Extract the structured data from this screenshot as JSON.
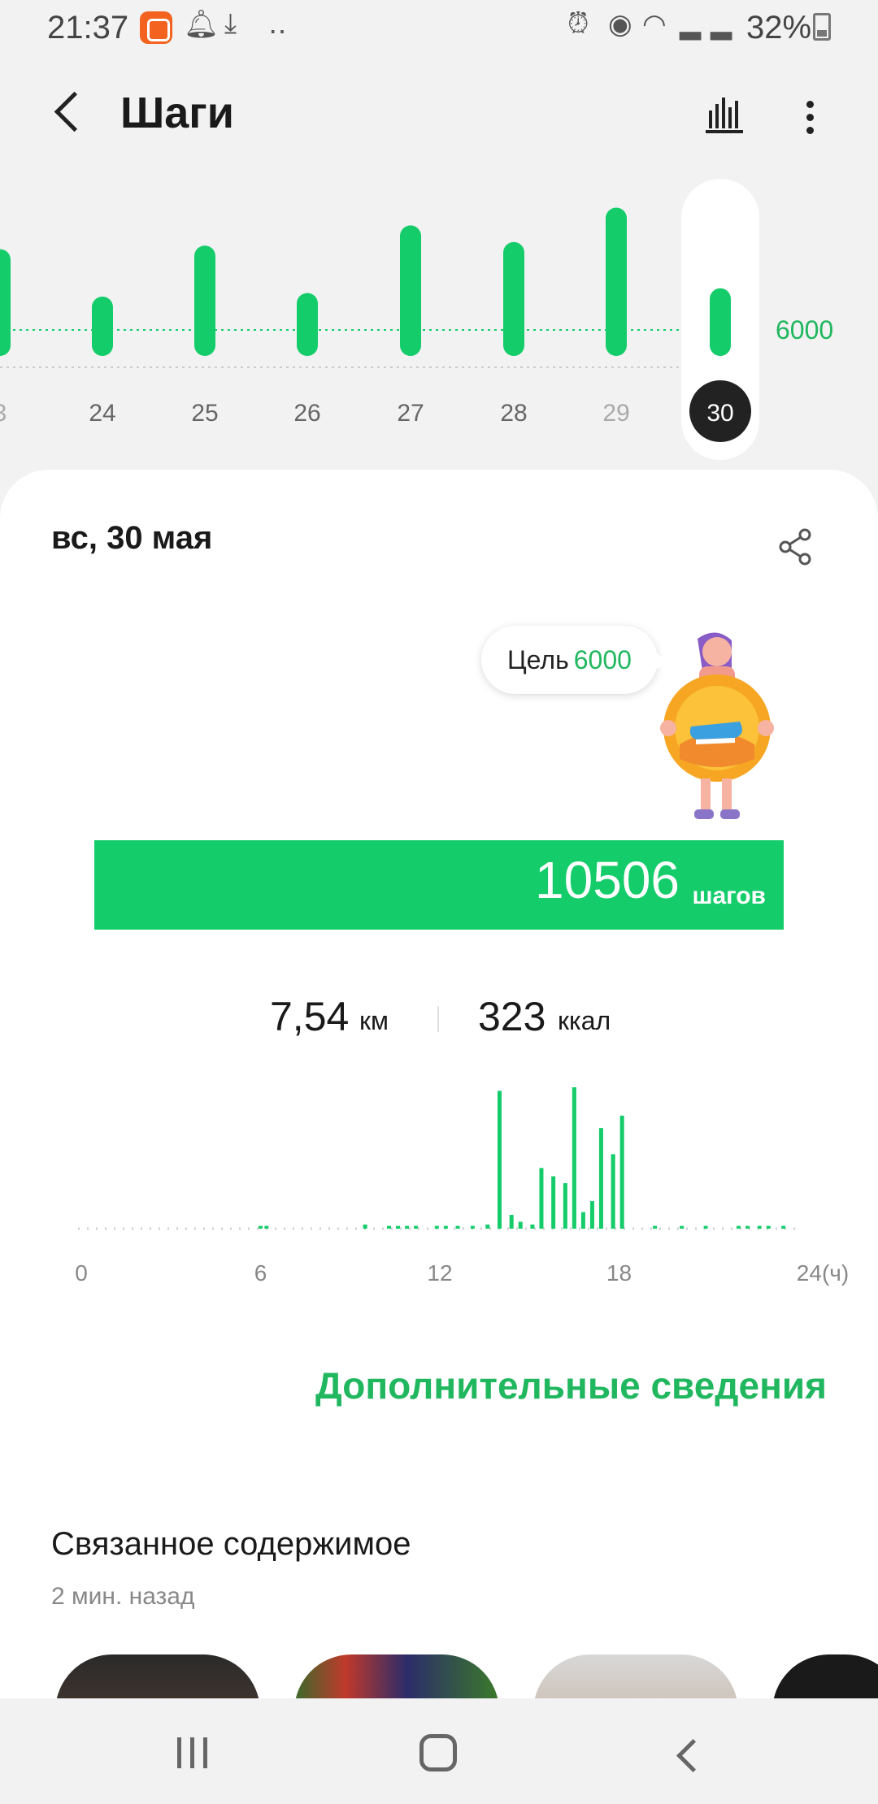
{
  "status_bar": {
    "time": "21:37",
    "battery": "32%",
    "icons": [
      "app-badge-icon",
      "notification-bell-icon",
      "download-icon",
      "more-dots-icon",
      "alarm-icon",
      "location-icon",
      "wifi-icon",
      "signal-icon",
      "signal-icon",
      "battery-icon"
    ]
  },
  "header": {
    "title": "Шаги",
    "back_icon": "chevron-left-icon",
    "stats_icon": "bar-chart-icon",
    "menu_icon": "more-vertical-icon"
  },
  "week_chart": {
    "goal_label": "6000",
    "goal_value": 6000,
    "days": [
      "3",
      "24",
      "25",
      "26",
      "27",
      "28",
      "29",
      "30"
    ],
    "selected_day": "30",
    "values": [
      9000,
      5000,
      9300,
      5300,
      11000,
      9600,
      12500,
      5700
    ],
    "colors": {
      "bar": "#14cc6a",
      "label": "#666666",
      "label_muted": "#aaaaaa",
      "selected": "#222222"
    }
  },
  "card": {
    "date": "вс, 30 мая",
    "share_icon": "share-icon",
    "goal_bubble": {
      "label": "Цель",
      "value": "6000"
    },
    "steps": {
      "value": "10506",
      "unit": "шагов"
    },
    "distance": {
      "value": "7,54",
      "unit": "км"
    },
    "calories": {
      "value": "323",
      "unit": "ккал"
    },
    "more_info": "Дополнительные сведения",
    "related": {
      "title": "Связанное содержимое",
      "time": "2 мин. назад"
    }
  },
  "chart_data": {
    "type": "bar",
    "x": [
      6.0,
      6.2,
      9.5,
      10.3,
      10.6,
      10.9,
      11.2,
      11.9,
      12.2,
      12.6,
      13.1,
      13.6,
      14.0,
      14.4,
      14.7,
      15.1,
      15.4,
      15.8,
      16.2,
      16.5,
      16.8,
      17.1,
      17.4,
      17.8,
      18.1,
      19.2,
      20.1,
      20.9,
      22.0,
      22.3,
      22.7,
      23.0,
      23.5
    ],
    "values": [
      2,
      2,
      3,
      2,
      2,
      2,
      2,
      2,
      2,
      2,
      2,
      3,
      100,
      10,
      5,
      3,
      44,
      38,
      33,
      112,
      12,
      20,
      73,
      54,
      82,
      2,
      2,
      2,
      2,
      2,
      2,
      2,
      2
    ],
    "x_ticks": [
      "0",
      "6",
      "12",
      "18",
      "24(ч)"
    ],
    "xlim": [
      0,
      24
    ],
    "xlabel": "",
    "ylabel": "",
    "color": "#14cc6a"
  },
  "nav_bar": {
    "icons": [
      "recents-icon",
      "home-icon",
      "back-icon"
    ]
  }
}
